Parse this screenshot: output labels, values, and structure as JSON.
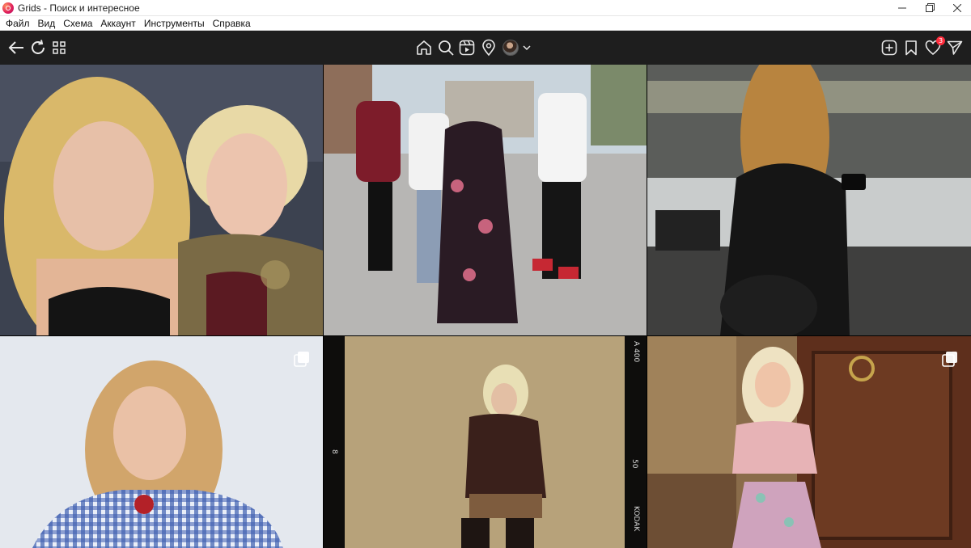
{
  "window": {
    "title": "Grids - Поиск и интересное",
    "controls": {
      "minimize": "minimize-icon",
      "restore": "restore-icon",
      "close": "close-icon"
    }
  },
  "menu": {
    "items": [
      "Файл",
      "Вид",
      "Схема",
      "Аккаунт",
      "Инструменты",
      "Справка"
    ]
  },
  "toolbar": {
    "left_icons": [
      "back-arrow-icon",
      "refresh-icon",
      "grid-view-icon"
    ],
    "center_icons": [
      "home-icon",
      "search-icon",
      "reels-icon",
      "location-pin-icon",
      "account-avatar",
      "chevron-down-icon"
    ],
    "right_icons": [
      "add-post-icon",
      "bookmark-icon",
      "heart-icon",
      "direct-send-icon"
    ],
    "notification_count": "3",
    "badge_color": "#ff2d3d"
  },
  "grid": {
    "columns": 3,
    "tiles": [
      {
        "subject": "two blonde women selfie, party",
        "multi": false
      },
      {
        "subject": "four young people dancing on street",
        "multi": false
      },
      {
        "subject": "woman in black leather at stadium",
        "multi": false
      },
      {
        "subject": "blonde woman in blue gingham top",
        "multi": true
      },
      {
        "subject": "blonde woman in brown sweater, film frame",
        "multi": false,
        "film_text": [
          "A 400",
          "8",
          "50",
          "KODAK"
        ]
      },
      {
        "subject": "blonde woman in floral dress by wooden door",
        "multi": true
      }
    ]
  },
  "colors": {
    "toolbar_bg": "#1e1e1e",
    "titlebar_bg": "#ffffff"
  }
}
